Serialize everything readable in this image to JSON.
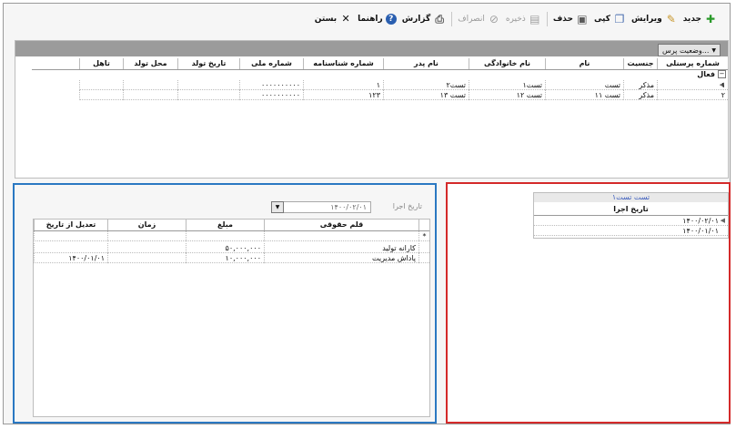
{
  "toolbar": {
    "new_label": "جدید",
    "edit_label": "ویرایش",
    "copy_label": "کپی",
    "delete_label": "حذف",
    "save_label": "ذخیره",
    "cancel_label": "انصراف",
    "report_label": "گزارش",
    "help_label": "راهنما",
    "close_label": "بستن"
  },
  "top_grid": {
    "group_chip": "وضعیت پرس...",
    "columns": [
      "شماره پرسنلی",
      "جنسیت",
      "نام",
      "نام خانوادگی",
      "نام پدر",
      "شماره شناسنامه",
      "شماره ملی",
      "تاریخ تولد",
      "محل تولد",
      "تاهل"
    ],
    "group_label": "فعال",
    "rows": [
      [
        "۱",
        "مذکر",
        "تست",
        "تست۱",
        "تست۲",
        "۱",
        "۰۰۰۰۰۰۰۰۰۰",
        "",
        "",
        ""
      ],
      [
        "۲",
        "مذکر",
        "تست ۱۱",
        "تست ۱۲",
        "تست ۱۳",
        "۱۲۳",
        "۰۰۰۰۰۰۰۰۰۰",
        "",
        "",
        ""
      ]
    ]
  },
  "left_panel": {
    "date_label": "تاریخ اجرا",
    "date_value": "۱۴۰۰/۰۲/۰۱",
    "columns": [
      "قلم حقوقی",
      "مبلغ",
      "زمان",
      "تعدیل از تاریخ"
    ],
    "rows": [
      [
        "کارانه تولید",
        "۵۰,۰۰۰,۰۰۰",
        "",
        ""
      ],
      [
        "پاداش مدیریت",
        "۱۰,۰۰۰,۰۰۰",
        "",
        "۱۴۰۰/۰۱/۰۱"
      ]
    ]
  },
  "right_panel": {
    "title": "تست تست۱",
    "column": "تاریخ اجرا",
    "rows": [
      "۱۴۰۰/۰۲/۰۱",
      "۱۴۰۰/۰۱/۰۱"
    ]
  },
  "colors": {
    "left_border": "#2a78c2",
    "right_border": "#d42a2a",
    "group_bar": "#9b9b9b"
  }
}
